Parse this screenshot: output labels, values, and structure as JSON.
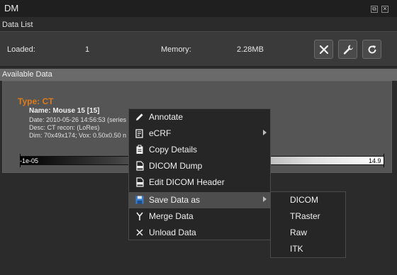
{
  "window": {
    "title": "DM",
    "float_icon": "restore-icon",
    "close_icon": "close-icon"
  },
  "data_list": {
    "label": "Data List",
    "loaded_label": "Loaded:",
    "loaded_value": "1",
    "memory_label": "Memory:",
    "memory_value": "2.28MB",
    "buttons": [
      "close-icon",
      "wrench-icon",
      "refresh-icon"
    ]
  },
  "available": {
    "header": "Available Data",
    "item": {
      "type": "Type: CT",
      "name": "Name: Mouse 15 [15]",
      "date": "Date: 2010-05-26 14:56:53 (series",
      "desc": "Desc: CT recon: (LoRes)",
      "dim": "Dim: 70x49x174; Vox: 0.50x0.50 n",
      "range_min": "-1e-05",
      "range_max": "14.9"
    }
  },
  "context_menu": {
    "items": [
      {
        "label": "Annotate",
        "icon": "pencil-icon",
        "submenu": false
      },
      {
        "label": "eCRF",
        "icon": "document-icon",
        "submenu": true
      },
      {
        "label": "Copy Details",
        "icon": "clipboard-icon",
        "submenu": false
      },
      {
        "label": "DICOM Dump",
        "icon": "dicom-file-icon",
        "submenu": false
      },
      {
        "label": "Edit DICOM Header",
        "icon": "dicom-file-icon",
        "submenu": false
      },
      {
        "label": "Save Data as",
        "icon": "floppy-disk-icon",
        "submenu": true,
        "highlighted": true
      },
      {
        "label": "Merge Data",
        "icon": "merge-icon",
        "submenu": false
      },
      {
        "label": "Unload Data",
        "icon": "x-icon",
        "submenu": false
      }
    ]
  },
  "save_submenu": {
    "items": [
      "DICOM",
      "TRaster",
      "Raw",
      "ITK"
    ]
  },
  "colors": {
    "accent_type": "#e07b1a",
    "menu_bg": "#262626",
    "menu_highlight": "#4d4d4d",
    "floppy_blue": "#3b7fd1"
  }
}
